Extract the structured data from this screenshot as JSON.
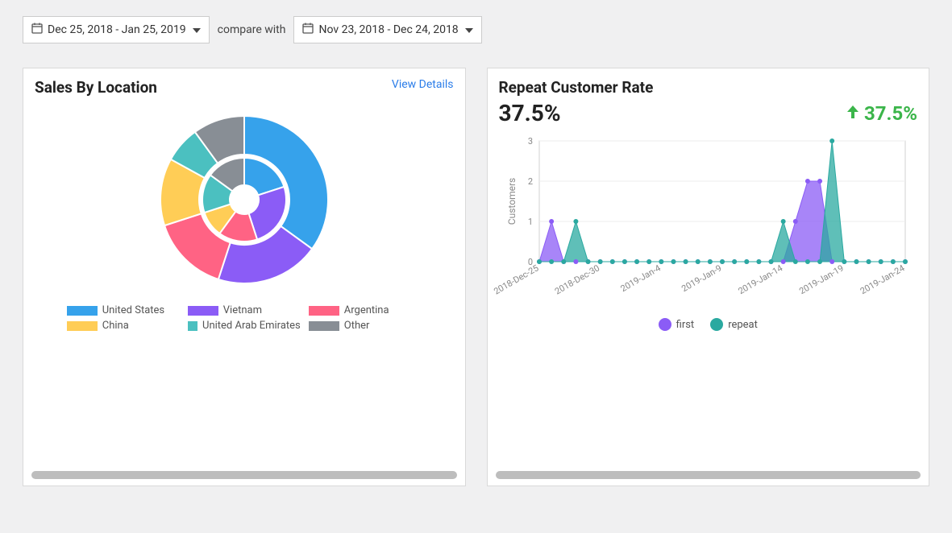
{
  "toolbar": {
    "date_range_primary": "Dec 25, 2018 - Jan 25, 2019",
    "compare_label": "compare with",
    "date_range_compare": "Nov 23, 2018 - Dec 24, 2018"
  },
  "cards": {
    "sales_by_location": {
      "title": "Sales By Location",
      "view_details": "View Details",
      "legend": [
        {
          "label": "United States",
          "color": "#36a2eb"
        },
        {
          "label": "Vietnam",
          "color": "#8b5cf6"
        },
        {
          "label": "Argentina",
          "color": "#ff6384"
        },
        {
          "label": "China",
          "color": "#ffcd56"
        },
        {
          "label": "United Arab Emirates",
          "color": "#4bc0c0"
        },
        {
          "label": "Other",
          "color": "#888e95"
        }
      ]
    },
    "repeat_customer_rate": {
      "title": "Repeat Customer Rate",
      "value": "37.5%",
      "change": "37.5%",
      "legend": [
        {
          "label": "first",
          "color": "#8b5cf6"
        },
        {
          "label": "repeat",
          "color": "#2aa9a0"
        }
      ],
      "ylabel": "Customers"
    }
  },
  "chart_data": [
    {
      "type": "pie",
      "title": "Sales By Location",
      "rings": 2,
      "series": [
        {
          "name": "outer",
          "values": [
            {
              "label": "United States",
              "value": 35,
              "color": "#36a2eb"
            },
            {
              "label": "Vietnam",
              "value": 20,
              "color": "#8b5cf6"
            },
            {
              "label": "Argentina",
              "value": 15,
              "color": "#ff6384"
            },
            {
              "label": "China",
              "value": 13,
              "color": "#ffcd56"
            },
            {
              "label": "United Arab Emirates",
              "value": 7,
              "color": "#4bc0c0"
            },
            {
              "label": "Other",
              "value": 10,
              "color": "#888e95"
            }
          ]
        },
        {
          "name": "inner",
          "values": [
            {
              "label": "United States",
              "value": 20,
              "color": "#36a2eb"
            },
            {
              "label": "Vietnam",
              "value": 25,
              "color": "#8b5cf6"
            },
            {
              "label": "Argentina",
              "value": 15,
              "color": "#ff6384"
            },
            {
              "label": "China",
              "value": 10,
              "color": "#ffcd56"
            },
            {
              "label": "United Arab Emirates",
              "value": 15,
              "color": "#4bc0c0"
            },
            {
              "label": "Other",
              "value": 15,
              "color": "#888e95"
            }
          ]
        }
      ]
    },
    {
      "type": "area",
      "title": "Repeat Customer Rate",
      "xlabel": "",
      "ylabel": "Customers",
      "ylim": [
        0,
        3
      ],
      "x": [
        "2018-Dec-25",
        "2018-Dec-26",
        "2018-Dec-27",
        "2018-Dec-28",
        "2018-Dec-29",
        "2018-Dec-30",
        "2018-Dec-31",
        "2019-Jan-1",
        "2019-Jan-2",
        "2019-Jan-3",
        "2019-Jan-4",
        "2019-Jan-5",
        "2019-Jan-6",
        "2019-Jan-7",
        "2019-Jan-8",
        "2019-Jan-9",
        "2019-Jan-10",
        "2019-Jan-11",
        "2019-Jan-12",
        "2019-Jan-13",
        "2019-Jan-14",
        "2019-Jan-15",
        "2019-Jan-16",
        "2019-Jan-17",
        "2019-Jan-18",
        "2019-Jan-19",
        "2019-Jan-20",
        "2019-Jan-21",
        "2019-Jan-22",
        "2019-Jan-23",
        "2019-Jan-24"
      ],
      "x_tick_labels": [
        "2018-Dec-25",
        "2018-Dec-30",
        "2019-Jan-4",
        "2019-Jan-9",
        "2019-Jan-14",
        "2019-Jan-19",
        "2019-Jan-24"
      ],
      "series": [
        {
          "name": "first",
          "color": "#8b5cf6",
          "values": [
            0,
            1,
            0,
            0,
            0,
            0,
            0,
            0,
            0,
            0,
            0,
            0,
            0,
            0,
            0,
            0,
            0,
            0,
            0,
            0,
            0,
            1,
            2,
            2,
            0,
            0,
            0,
            0,
            0,
            0,
            0
          ]
        },
        {
          "name": "repeat",
          "color": "#2aa9a0",
          "values": [
            0,
            0,
            0,
            1,
            0,
            0,
            0,
            0,
            0,
            0,
            0,
            0,
            0,
            0,
            0,
            0,
            0,
            0,
            0,
            0,
            1,
            0,
            0,
            0,
            3,
            0,
            0,
            0,
            0,
            0,
            0
          ]
        }
      ]
    }
  ]
}
